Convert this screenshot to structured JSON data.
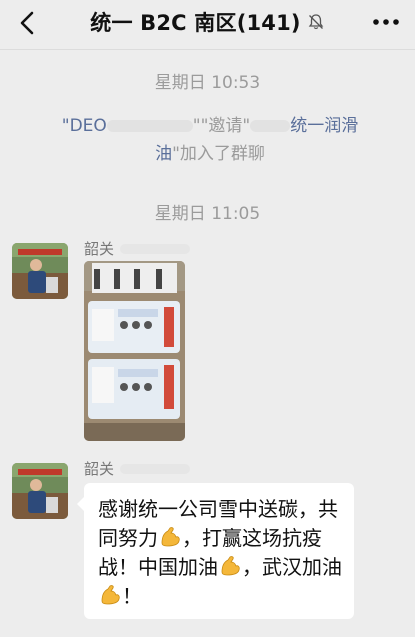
{
  "nav": {
    "title": "统一 B2C 南区(141)",
    "back_icon": "chevron-left-icon",
    "mute_icon": "bell-muted-icon",
    "more_icon": "more-dots-icon"
  },
  "messages": {
    "time1": "星期日 10:53",
    "system_q1": "\"",
    "system_name1": "DEO",
    "system_mid": "\"",
    "system_invite": "\"邀请\"",
    "system_name2_a": "统一润滑",
    "system_name2_b": "油",
    "system_tail": "\"加入了群聊",
    "time2": "星期日 11:05",
    "sender1": "韶关",
    "sender2": "韶关",
    "text_parts": {
      "p1": "感谢统一公司雪中送碳，共同努力",
      "p2": "，打赢这场抗疫战！中国加油",
      "p3": "，武汉加油",
      "p4": "！"
    },
    "emoji_name": "flexed-biceps-icon"
  },
  "colors": {
    "background": "#ededed",
    "link": "#5a6f9a",
    "muted_text": "#9b9b9b",
    "bubble": "#ffffff"
  }
}
